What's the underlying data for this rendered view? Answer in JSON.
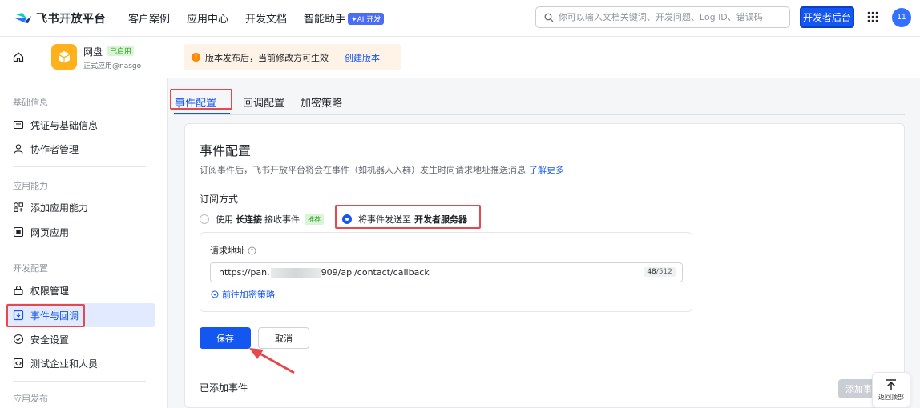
{
  "topbar": {
    "logo_text": "飞书开放平台",
    "nav": [
      "客户案例",
      "应用中心",
      "开发文档",
      "智能助手"
    ],
    "ai_badge": "AI 开发",
    "search_placeholder": "你可以输入文档关键词、开发问题、Log ID、错误码",
    "dev_console_label": "开发者后台",
    "avatar_text": "11"
  },
  "app": {
    "name": "网盘",
    "status_badge": "已启用",
    "subtitle": "正式应用@nasgo"
  },
  "notice": {
    "text": "版本发布后，当前修改方可生效",
    "link": "创建版本"
  },
  "sidebar": {
    "groups": [
      {
        "label": "基础信息",
        "items": [
          "凭证与基础信息",
          "协作者管理"
        ]
      },
      {
        "label": "应用能力",
        "items": [
          "添加应用能力",
          "网页应用"
        ]
      },
      {
        "label": "开发配置",
        "items": [
          "权限管理",
          "事件与回调",
          "安全设置",
          "测试企业和人员"
        ]
      },
      {
        "label": "应用发布",
        "items": []
      }
    ],
    "active_item": "事件与回调"
  },
  "tabs": [
    "事件配置",
    "回调配置",
    "加密策略"
  ],
  "active_tab": "事件配置",
  "event_config": {
    "title": "事件配置",
    "description": "订阅事件后，飞书开放平台将会在事件（如机器人入群）发生时向请求地址推送消息",
    "learn_more": "了解更多",
    "subscription_label": "订阅方式",
    "option_long_conn": {
      "prefix": "使用",
      "bold": "长连接",
      "suffix": "接收事件",
      "badge": "推荐"
    },
    "option_server": {
      "prefix": "将事件发送至",
      "bold": "开发者服务器"
    },
    "request_url_label": "请求地址",
    "request_url_start": "https://pan.",
    "request_url_end": "909/api/contact/callback",
    "char_count": "48",
    "char_max": "/512",
    "encryption_link": "前往加密策略",
    "save_label": "保存",
    "cancel_label": "取消",
    "added_events_title": "已添加事件",
    "add_event_label": "添加事件",
    "back_to_top_label": "返回顶部"
  },
  "colors": {
    "primary": "#1456f0",
    "annotation_red": "#e5484d",
    "notice_bg": "#fef3e6",
    "success_green": "#2ea121"
  }
}
